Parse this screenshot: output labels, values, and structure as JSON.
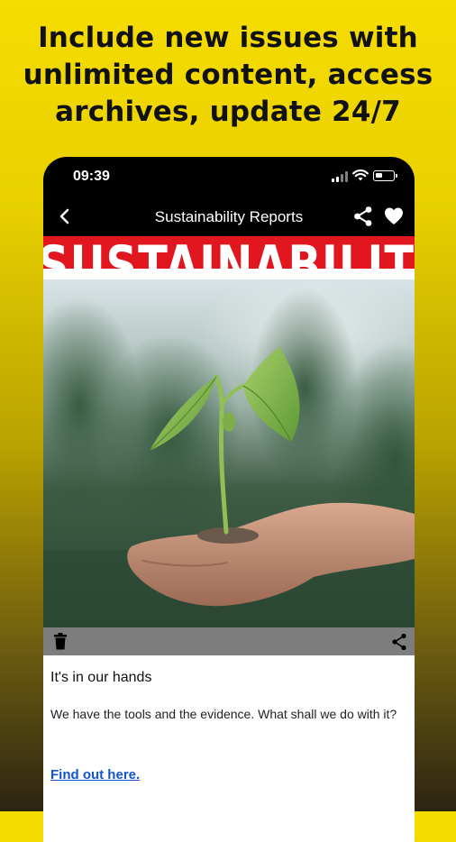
{
  "headline": {
    "line1": "Include new issues with",
    "line2": "unlimited content, access",
    "line3": "archives, update 24/7"
  },
  "status_bar": {
    "time": "09:39"
  },
  "navbar": {
    "title": "Sustainability Reports"
  },
  "banner": {
    "text": "SUSTAINABILITY"
  },
  "article": {
    "title": "It's in our hands",
    "body": "We have the tools and the evidence. What shall we do with it?",
    "link": "Find out here."
  },
  "icons": {
    "back": "chevron-left-icon",
    "share": "share-icon",
    "favorite": "heart-icon",
    "delete": "trash-icon"
  },
  "colors": {
    "background_top": "#f5dd00",
    "background_bottom": "#2c2412",
    "banner": "#e2161e",
    "link": "#1155cc",
    "toolbar": "#7d7d7d"
  }
}
